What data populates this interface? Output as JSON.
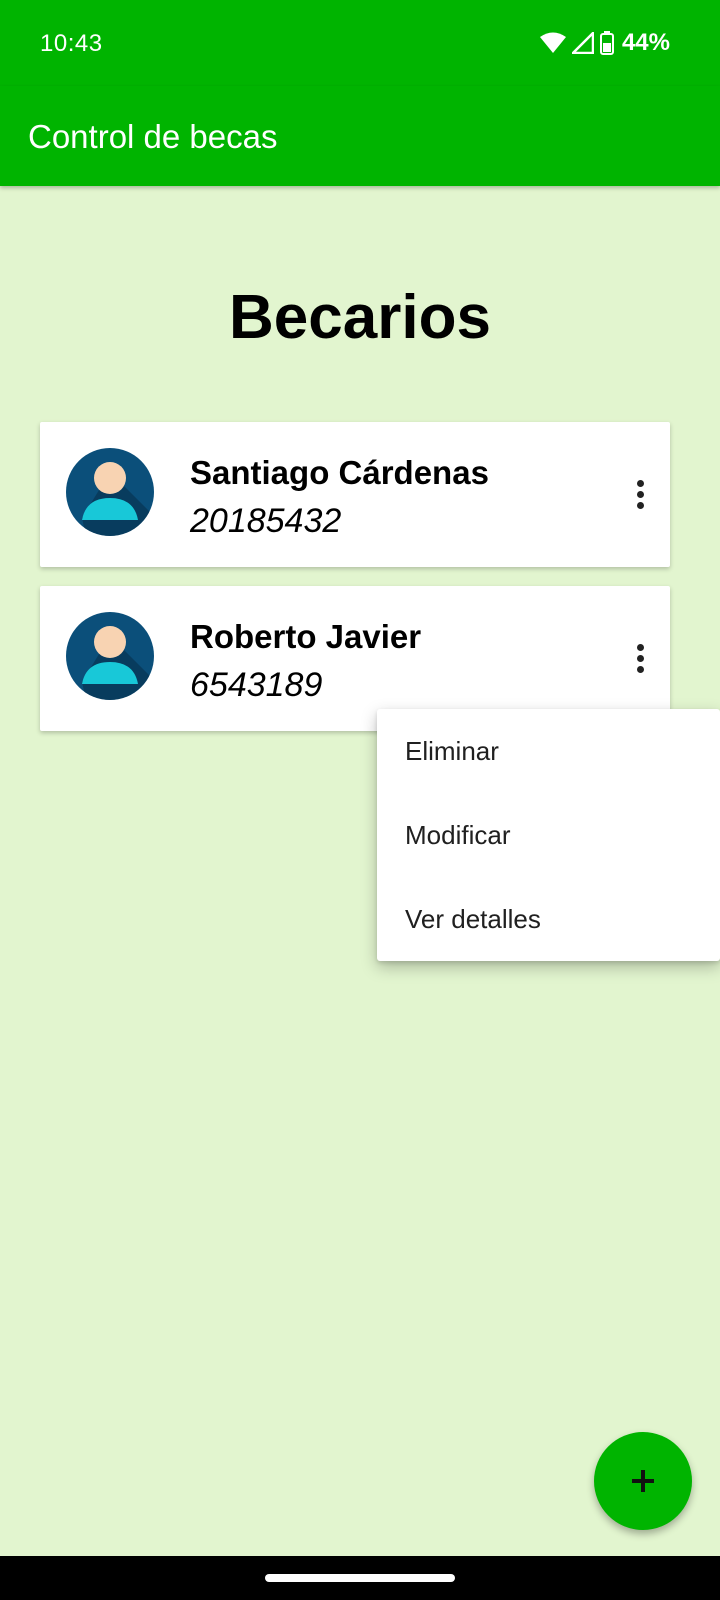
{
  "status_bar": {
    "time": "10:43",
    "battery": "44%",
    "icons": [
      "wifi-icon",
      "cell-signal-icon",
      "battery-icon"
    ]
  },
  "app_bar": {
    "title": "Control de becas",
    "color": "#00b400"
  },
  "page": {
    "heading": "Becarios",
    "background": "#e2f5cf"
  },
  "becarios": [
    {
      "name": "Santiago Cárdenas",
      "id": "20185432",
      "avatar_icon": "person-avatar-icon",
      "menu_icon": "more-vert-icon"
    },
    {
      "name": "Roberto Javier",
      "id": "6543189",
      "avatar_icon": "person-avatar-icon",
      "menu_icon": "more-vert-icon"
    }
  ],
  "context_menu": {
    "items": [
      "Eliminar",
      "Modificar",
      "Ver detalles"
    ]
  },
  "fab": {
    "icon": "plus-icon",
    "color": "#00b400"
  }
}
